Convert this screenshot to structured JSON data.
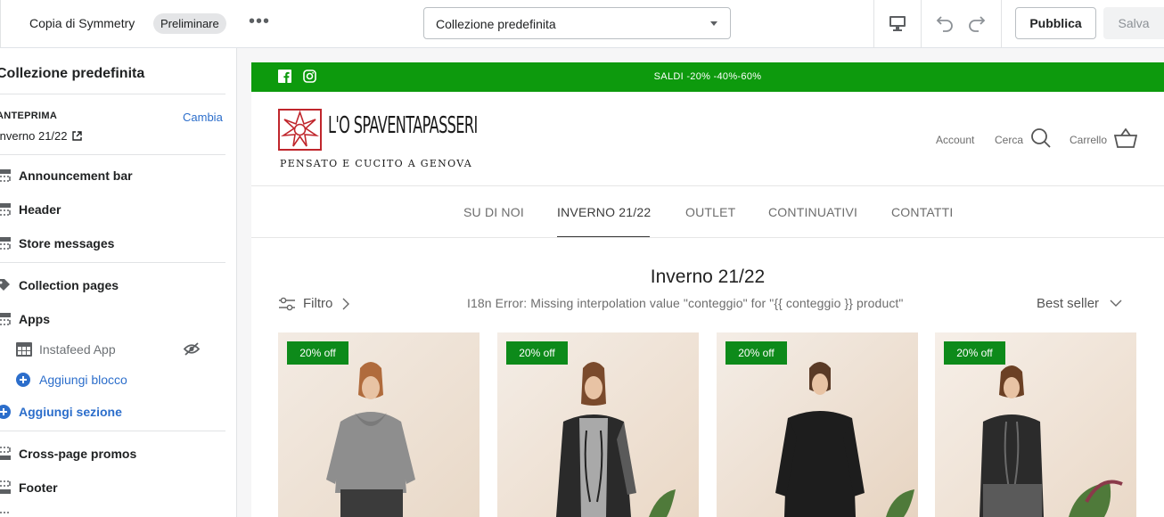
{
  "topbar": {
    "theme_name": "Copia di Symmetry",
    "status_badge": "Preliminare",
    "more_label": "•••",
    "template_select": "Collezione predefinita",
    "publish_label": "Pubblica",
    "save_label": "Salva"
  },
  "sidebar": {
    "heading": "Collezione predefinita",
    "preview_label": "ANTEPRIMA",
    "change_label": "Cambia",
    "preview_value": "Inverno 21/22",
    "sections": [
      {
        "label": "Announcement bar"
      },
      {
        "label": "Header"
      },
      {
        "label": "Store messages"
      },
      {
        "label": "Collection pages"
      },
      {
        "label": "Apps"
      }
    ],
    "app_block": "Instafeed App",
    "add_block": "Aggiungi blocco",
    "add_section": "Aggiungi sezione",
    "footer_sections": [
      {
        "label": "Cross-page promos"
      },
      {
        "label": "Footer"
      }
    ]
  },
  "store": {
    "announcement": "SALDI -20% -40%-60%",
    "brand_name": "L'O SPAVENTAPASSERI",
    "brand_tagline": "PENSATO E CUCITO A GENOVA",
    "header_links": {
      "account": "Account",
      "search": "Cerca",
      "cart": "Carrello"
    },
    "nav": [
      {
        "label": "SU DI NOI"
      },
      {
        "label": "INVERNO 21/22"
      },
      {
        "label": "OUTLET"
      },
      {
        "label": "CONTINUATIVI"
      },
      {
        "label": "CONTATTI"
      }
    ],
    "active_nav": "INVERNO 21/22",
    "collection_title": "Inverno 21/22",
    "filter_label": "Filtro",
    "product_count_text": "I18n Error: Missing interpolation value \"conteggio\" for \"{{ conteggio }} product\"",
    "sort_label": "Best seller",
    "products": [
      {
        "badge": "20% off"
      },
      {
        "badge": "20% off"
      },
      {
        "badge": "20% off"
      },
      {
        "badge": "20% off"
      }
    ]
  },
  "colors": {
    "announcement_bg": "#0d9a0d",
    "badge_bg": "#0d8a1a",
    "link_blue": "#2c6ecb",
    "logo_red": "#c0262c"
  },
  "icons": [
    "facebook-icon",
    "instagram-icon",
    "search-icon",
    "cart-icon",
    "desktop-icon",
    "undo-icon",
    "redo-icon",
    "hidden-eye-icon",
    "external-link-icon",
    "filter-icon",
    "chevron-right-icon",
    "chevron-down-icon",
    "section-icon",
    "tag-icon",
    "apps-icon",
    "plus-circle-icon"
  ]
}
